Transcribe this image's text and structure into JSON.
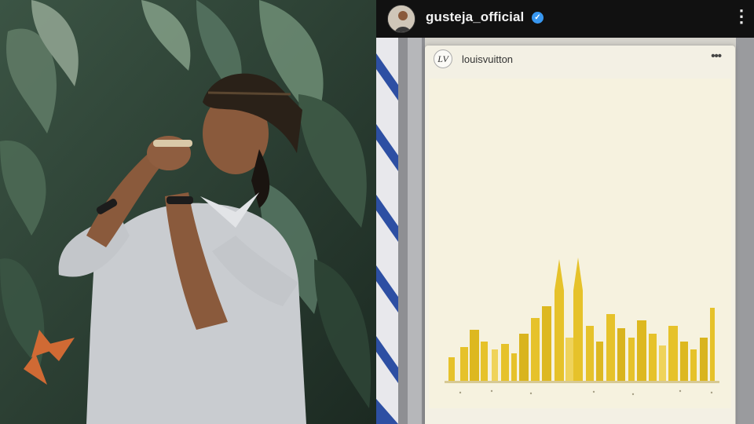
{
  "left_photo": {
    "subject": "man-playing-flute",
    "colors": {
      "foliage": "#2f4a3a",
      "shirt": "#c9ccd0",
      "headwrap": "#2a2118",
      "skin": "#8a5a3c"
    }
  },
  "post": {
    "username": "gusteja_official",
    "verified": true,
    "more_icon": "more-horizontal-icon"
  },
  "embedded_post": {
    "username": "louisvuitton",
    "logo_text": "LV",
    "more_icon": "more-horizontal-icon",
    "image": {
      "subject": "yellow-city-skyline",
      "colors": {
        "background": "#f6f2df",
        "skyline": "#e6c22a"
      }
    }
  }
}
